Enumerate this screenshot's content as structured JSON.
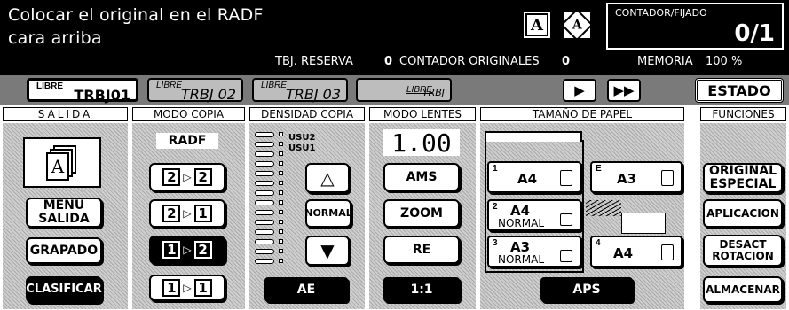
{
  "header": {
    "message_line1": "Colocar el original en el RADF",
    "message_line2": "cara arriba",
    "mode_icon_1": "A",
    "mode_icon_2": "A",
    "counter_label": "CONTADOR/FIJADO",
    "counter_value": "0/1",
    "reserve_label": "TBJ. RESERVA",
    "reserve_value": "0",
    "originals_label": "CONTADOR ORIGINALES",
    "originals_value": "0",
    "memory_label": "MEMORIA",
    "memory_value": "100 %"
  },
  "jobs": {
    "tabs": [
      {
        "top": "LIBRE",
        "bottom": "TRBJ01"
      },
      {
        "top": "LIBRE",
        "bottom": "TRBJ 02"
      },
      {
        "top": "LIBRE",
        "bottom": "TRBJ 03"
      },
      {
        "top": "LIBRE",
        "bottom": "TRBJ"
      }
    ],
    "play_label": "▶",
    "ffwd_label": "▶▶",
    "status_label": "ESTADO"
  },
  "sections": {
    "salida": "SALIDA",
    "modo_copia": "MODO COPIA",
    "densidad": "DENSIDAD COPIA",
    "modo_lentes": "MODO LENTES",
    "tamano_papel": "TAMAÑO DE PAPEL",
    "funciones": "FUNCIONES"
  },
  "salida": {
    "icon": "A",
    "menu_salida": "MENU\nSALIDA",
    "grapado": "GRAPADO",
    "clasificar": "CLASIFICAR"
  },
  "modo_copia": {
    "mode_label": "RADF",
    "options": [
      {
        "from": "2",
        "to": "2"
      },
      {
        "from": "2",
        "to": "1"
      },
      {
        "from": "1",
        "to": "2"
      },
      {
        "from": "1",
        "to": "1"
      }
    ],
    "selected_index": 2
  },
  "densidad": {
    "usu2": "USU2",
    "usu1": "USU1",
    "up": "△",
    "normal": "NORMAL",
    "down": "▼",
    "ae": "AE"
  },
  "modo_lentes": {
    "ratio": "1.00",
    "ams": "AMS",
    "zoom": "ZOOM",
    "re": "RE",
    "one_to_one": "1:1"
  },
  "papel": {
    "trays": [
      {
        "idx": "1",
        "size": "A4",
        "sub": ""
      },
      {
        "idx": "E",
        "size": "A3",
        "sub": ""
      },
      {
        "idx": "2",
        "size": "A4",
        "sub": "NORMAL"
      },
      {
        "idx": "3",
        "size": "A3",
        "sub": "NORMAL"
      },
      {
        "idx": "4",
        "size": "A4",
        "sub": ""
      }
    ],
    "aps": "APS"
  },
  "funciones": {
    "original_especial": "ORIGINAL\nESPECIAL",
    "aplicacion": "APLICACION",
    "desact_rotacion": "DESACT\nROTACION",
    "almacenar": "ALMACENAR"
  }
}
